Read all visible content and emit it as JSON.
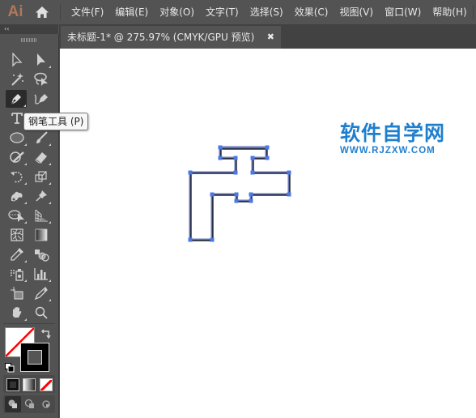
{
  "app": {
    "logo_text": "Ai",
    "brand_color": "#b0785a"
  },
  "menubar": {
    "items": [
      {
        "label": "文件(F)"
      },
      {
        "label": "编辑(E)"
      },
      {
        "label": "对象(O)"
      },
      {
        "label": "文字(T)"
      },
      {
        "label": "选择(S)"
      },
      {
        "label": "效果(C)"
      },
      {
        "label": "视图(V)"
      },
      {
        "label": "窗口(W)"
      },
      {
        "label": "帮助(H)"
      }
    ]
  },
  "toolpanel": {
    "collapse_glyph": "‹‹",
    "tools": [
      {
        "name": "selection-tool",
        "icon": "arrow-outline"
      },
      {
        "name": "direct-selection-tool",
        "icon": "arrow-filled"
      },
      {
        "name": "magic-wand-tool",
        "icon": "magic-wand"
      },
      {
        "name": "lasso-tool",
        "icon": "lasso"
      },
      {
        "name": "pen-tool",
        "icon": "pen",
        "active": true
      },
      {
        "name": "curvature-tool",
        "icon": "curvature-pen"
      },
      {
        "name": "type-tool",
        "icon": "type-T"
      },
      {
        "name": "line-tool",
        "icon": "line"
      },
      {
        "name": "ellipse-tool",
        "icon": "ellipse"
      },
      {
        "name": "paintbrush-tool",
        "icon": "brush"
      },
      {
        "name": "shaper-tool",
        "icon": "shaper"
      },
      {
        "name": "eraser-tool",
        "icon": "eraser"
      },
      {
        "name": "rotate-tool",
        "icon": "rotate"
      },
      {
        "name": "scale-tool",
        "icon": "scale"
      },
      {
        "name": "warp-tool",
        "icon": "warp"
      },
      {
        "name": "puppet-warp-tool",
        "icon": "pin"
      },
      {
        "name": "shape-builder-tool",
        "icon": "shape-builder"
      },
      {
        "name": "perspective-grid-tool",
        "icon": "perspective-grid"
      },
      {
        "name": "mesh-tool",
        "icon": "mesh"
      },
      {
        "name": "gradient-tool",
        "icon": "gradient"
      },
      {
        "name": "eyedropper-tool",
        "icon": "eyedropper"
      },
      {
        "name": "blend-tool",
        "icon": "blend"
      },
      {
        "name": "symbol-sprayer-tool",
        "icon": "symbol-sprayer"
      },
      {
        "name": "column-graph-tool",
        "icon": "bar-graph"
      },
      {
        "name": "artboard-tool",
        "icon": "artboard"
      },
      {
        "name": "slice-tool",
        "icon": "slice"
      },
      {
        "name": "hand-tool",
        "icon": "hand"
      },
      {
        "name": "zoom-tool",
        "icon": "magnifier"
      }
    ],
    "fill_stroke": {
      "fill": "none",
      "stroke": "#000000",
      "none_slash_color": "#ff0000"
    },
    "color_modes": [
      "color",
      "gradient",
      "none"
    ],
    "draw_modes": [
      "draw-normal",
      "draw-behind",
      "draw-inside"
    ]
  },
  "tooltip": {
    "text": "钢笔工具 (P)"
  },
  "document_tab": {
    "title": "未标题-1* @ 275.97% (CMYK/GPU 预览)",
    "close_glyph": "✖"
  },
  "canvas": {
    "shape": {
      "description": "faucet-shaped closed path with anchor points selected",
      "stroke_color": "#000000",
      "selection_color": "#4a78e8"
    },
    "watermark": {
      "title": "软件自学网",
      "url": "WWW.RJZXW.COM",
      "color": "#1f7fcf"
    }
  }
}
